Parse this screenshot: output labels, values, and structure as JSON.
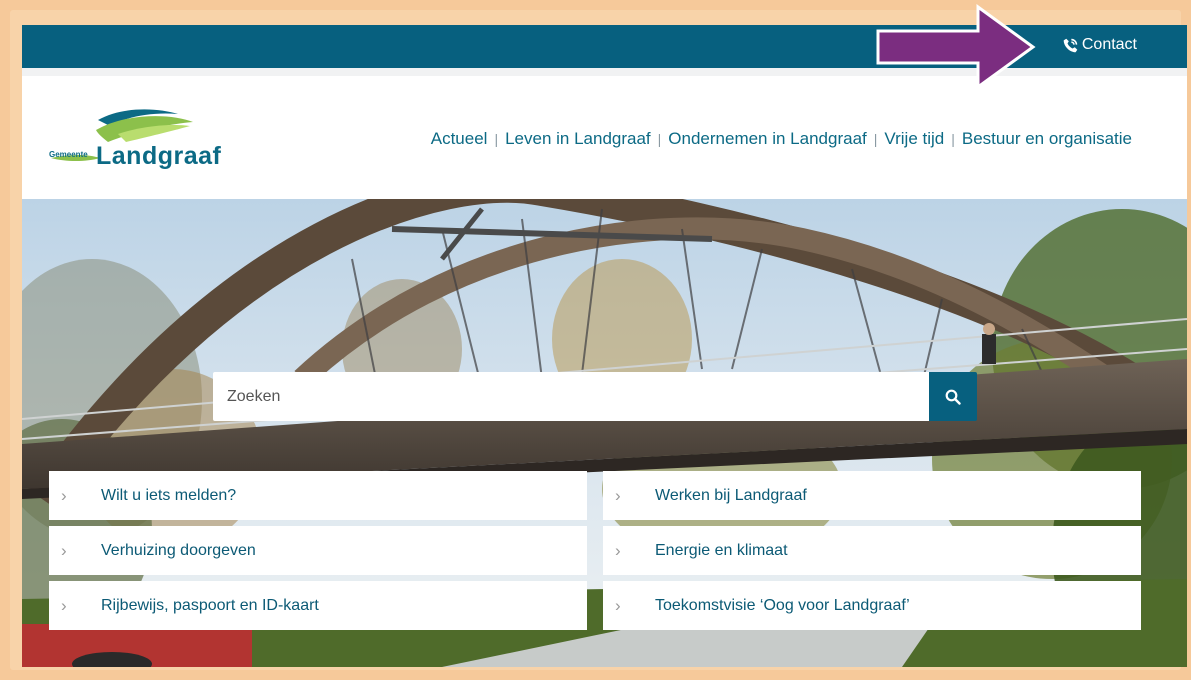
{
  "topbar": {
    "contact_label": "Contact"
  },
  "logo": {
    "small": "Gemeente",
    "word": "Landgraaf"
  },
  "nav": {
    "items": [
      "Actueel",
      "Leven in Landgraaf",
      "Ondernemen in Landgraaf",
      "Vrije tijd",
      "Bestuur en organisatie"
    ]
  },
  "search": {
    "placeholder": "Zoeken",
    "value": ""
  },
  "quicklinks": {
    "left": [
      "Wilt u iets melden?",
      "Verhuizing doorgeven",
      "Rijbewijs, paspoort en ID-kaart"
    ],
    "right": [
      "Werken bij Landgraaf",
      "Energie en klimaat",
      "Toekomstvisie ‘Oog voor Landgraaf’"
    ]
  },
  "colors": {
    "brand": "#07607f",
    "frame": "#f6c99a",
    "annotation_arrow": "#7b2d80",
    "logo_green": "#8cc04b",
    "logo_teal": "#0c6a85"
  },
  "icons": {
    "contact": "phone-icon",
    "search": "search-icon",
    "chevron": "chevron-right-icon",
    "annotation": "annotation-arrow-icon"
  }
}
